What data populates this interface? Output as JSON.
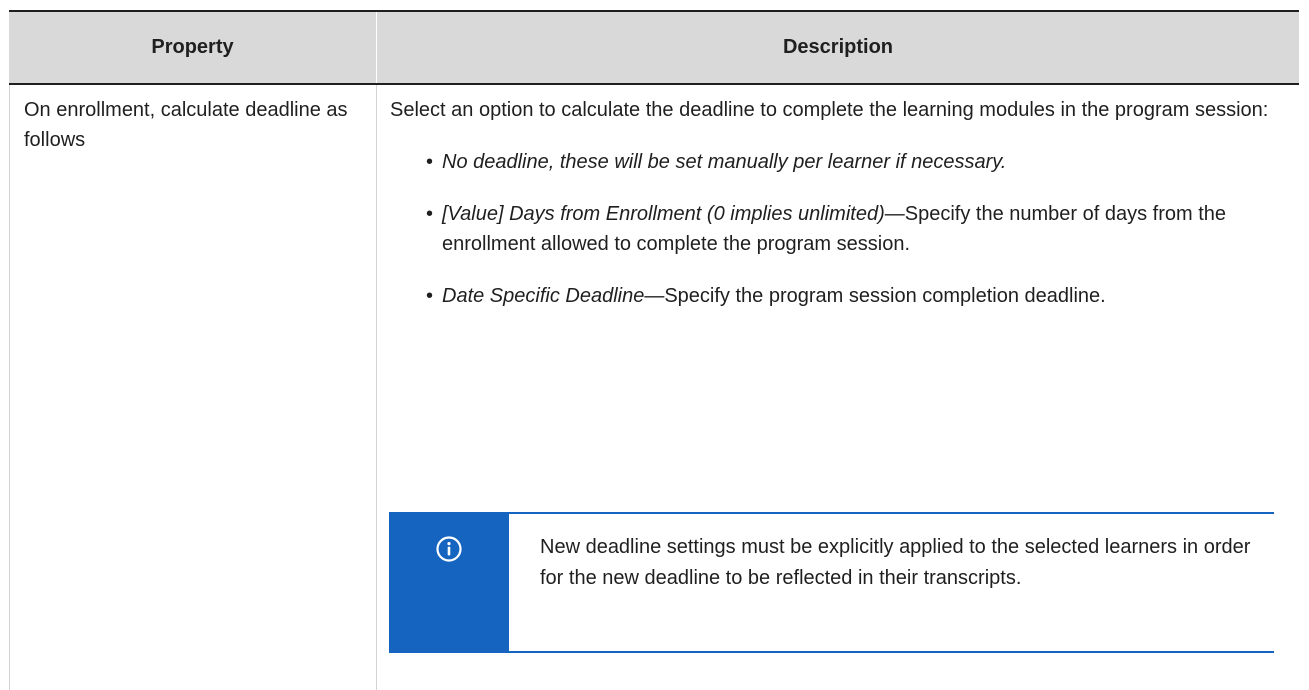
{
  "table": {
    "headers": {
      "property": "Property",
      "description": "Description"
    },
    "row": {
      "property": "On enrollment, calculate deadline as follows",
      "description_intro": "Select an option to calculate the deadline to complete the learning modules in the program session:",
      "options": [
        {
          "bullet": "•",
          "term": "No deadline, these will be set manually per learner if necessary.",
          "text": ""
        },
        {
          "bullet": "•",
          "term": "[Value] Days from Enrollment (0 implies unlimited)",
          "text": "—Specify the number of days from the enrollment allowed to complete the program session."
        },
        {
          "bullet": "•",
          "term": "Date Specific Deadline",
          "text": "—Specify the program session completion deadline."
        }
      ],
      "note": {
        "icon": "info-icon",
        "text": "New deadline settings must be explicitly applied to the selected learners in order for the new deadline to be reflected in their transcripts."
      }
    }
  },
  "colors": {
    "header_bg": "#d9d9d9",
    "note_accent": "#1565c0"
  }
}
